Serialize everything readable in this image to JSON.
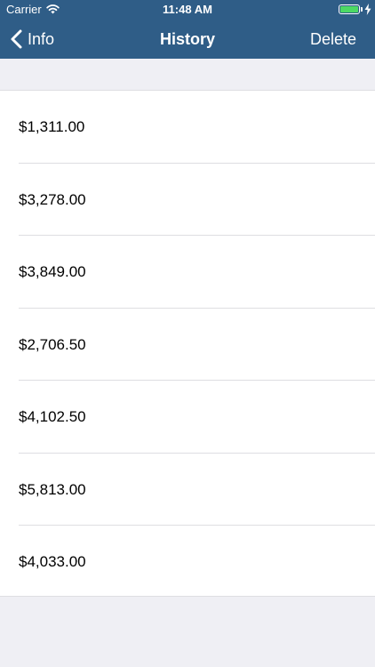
{
  "status_bar": {
    "carrier": "Carrier",
    "time": "11:48 AM",
    "battery_color": "#4cd964"
  },
  "nav": {
    "back_label": "Info",
    "title": "History",
    "action_label": "Delete",
    "background_color": "#2f5d87"
  },
  "history": {
    "items": [
      {
        "amount": "$1,311.00"
      },
      {
        "amount": "$3,278.00"
      },
      {
        "amount": "$3,849.00"
      },
      {
        "amount": "$2,706.50"
      },
      {
        "amount": "$4,102.50"
      },
      {
        "amount": "$5,813.00"
      },
      {
        "amount": "$4,033.00"
      }
    ]
  },
  "icons": [
    "wifi-icon",
    "battery-icon",
    "charging-bolt-icon",
    "chevron-left-icon"
  ]
}
